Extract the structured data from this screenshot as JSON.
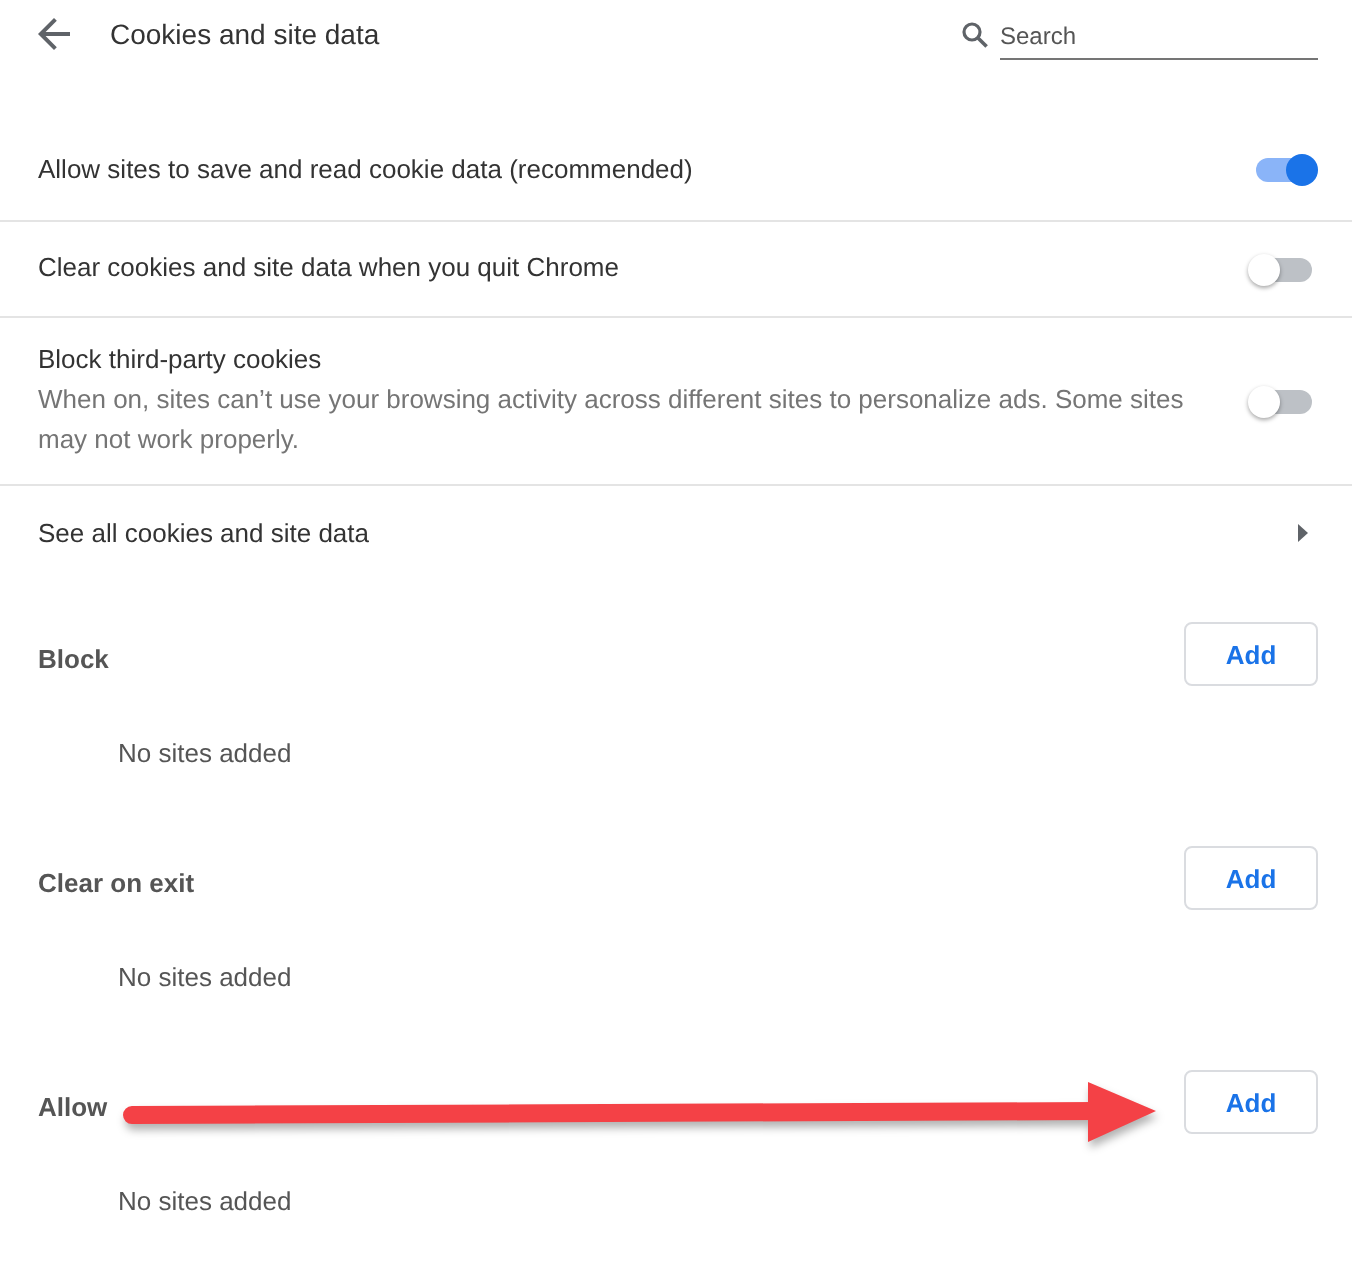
{
  "header": {
    "title": "Cookies and site data",
    "search": {
      "placeholder": "Search"
    }
  },
  "settings": [
    {
      "kind": "toggle",
      "label": "Allow sites to save and read cookie data (recommended)",
      "on": true
    },
    {
      "kind": "toggle",
      "label": "Clear cookies and site data when you quit Chrome",
      "on": false
    },
    {
      "kind": "toggle",
      "label": "Block third-party cookies",
      "description": "When on, sites can’t use your browsing activity across different sites to personalize ads. Some sites may not work properly.",
      "on": false
    },
    {
      "kind": "link",
      "label": "See all cookies and site data"
    }
  ],
  "sections": [
    {
      "title": "Block",
      "button": "Add",
      "empty_text": "No sites added",
      "arrow": false
    },
    {
      "title": "Clear on exit",
      "button": "Add",
      "empty_text": "No sites added",
      "arrow": false
    },
    {
      "title": "Allow",
      "button": "Add",
      "empty_text": "No sites added",
      "arrow": true
    }
  ]
}
